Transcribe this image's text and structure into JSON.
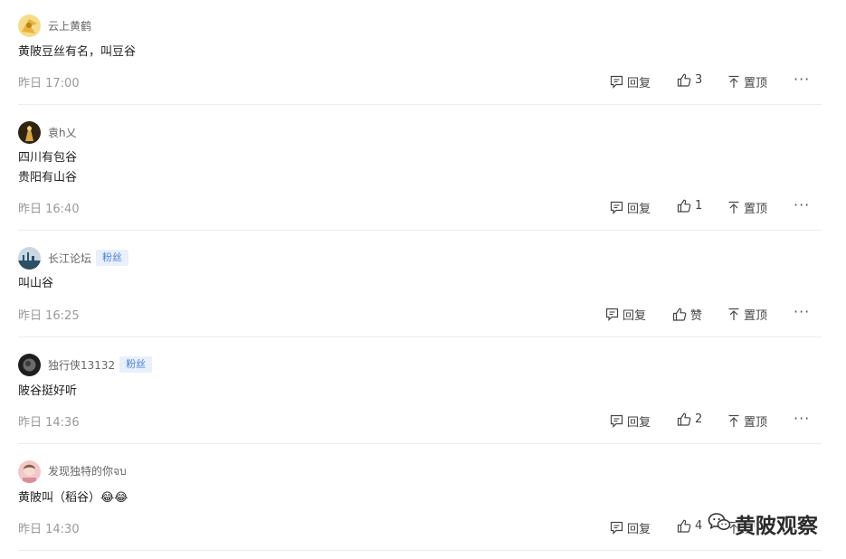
{
  "comments": [
    {
      "username": "云上黄鹤",
      "badge": "",
      "lines": [
        "黄陂豆丝有名，叫豆谷"
      ],
      "time": "昨日 17:00",
      "reply_label": "回复",
      "like_label": "3",
      "pin_label": "置顶",
      "more_label": "···",
      "avatar_colors": [
        "#e8b23c",
        "#f6dc8a"
      ]
    },
    {
      "username": "袁h乂",
      "badge": "",
      "lines": [
        "四川有包谷",
        "贵阳有山谷"
      ],
      "time": "昨日 16:40",
      "reply_label": "回复",
      "like_label": "1",
      "pin_label": "置顶",
      "more_label": "···",
      "avatar_colors": [
        "#2f2414",
        "#d9a441"
      ]
    },
    {
      "username": "长江论坛",
      "badge": "粉丝",
      "lines": [
        "叫山谷"
      ],
      "time": "昨日 16:25",
      "reply_label": "回复",
      "like_label": "赞",
      "pin_label": "置顶",
      "more_label": "···",
      "avatar_colors": [
        "#c9d7e3",
        "#2c5164"
      ]
    },
    {
      "username": "独行侠13132",
      "badge": "粉丝",
      "lines": [
        "陂谷挺好听"
      ],
      "time": "昨日 14:36",
      "reply_label": "回复",
      "like_label": "2",
      "pin_label": "置顶",
      "more_label": "···",
      "avatar_colors": [
        "#1e1e1e",
        "#6b6b6b"
      ]
    },
    {
      "username": "发现独特的你จบ",
      "badge": "",
      "lines": [
        "黄陂叫（稻谷）😂😂"
      ],
      "time": "昨日 14:30",
      "reply_label": "回复",
      "like_label": "4",
      "pin_label": "置顶",
      "more_label": "···",
      "avatar_colors": [
        "#f1c9c9",
        "#8a5a4a"
      ]
    }
  ],
  "watermark": {
    "text": "黄陂观察",
    "icon": "wechat-icon"
  }
}
